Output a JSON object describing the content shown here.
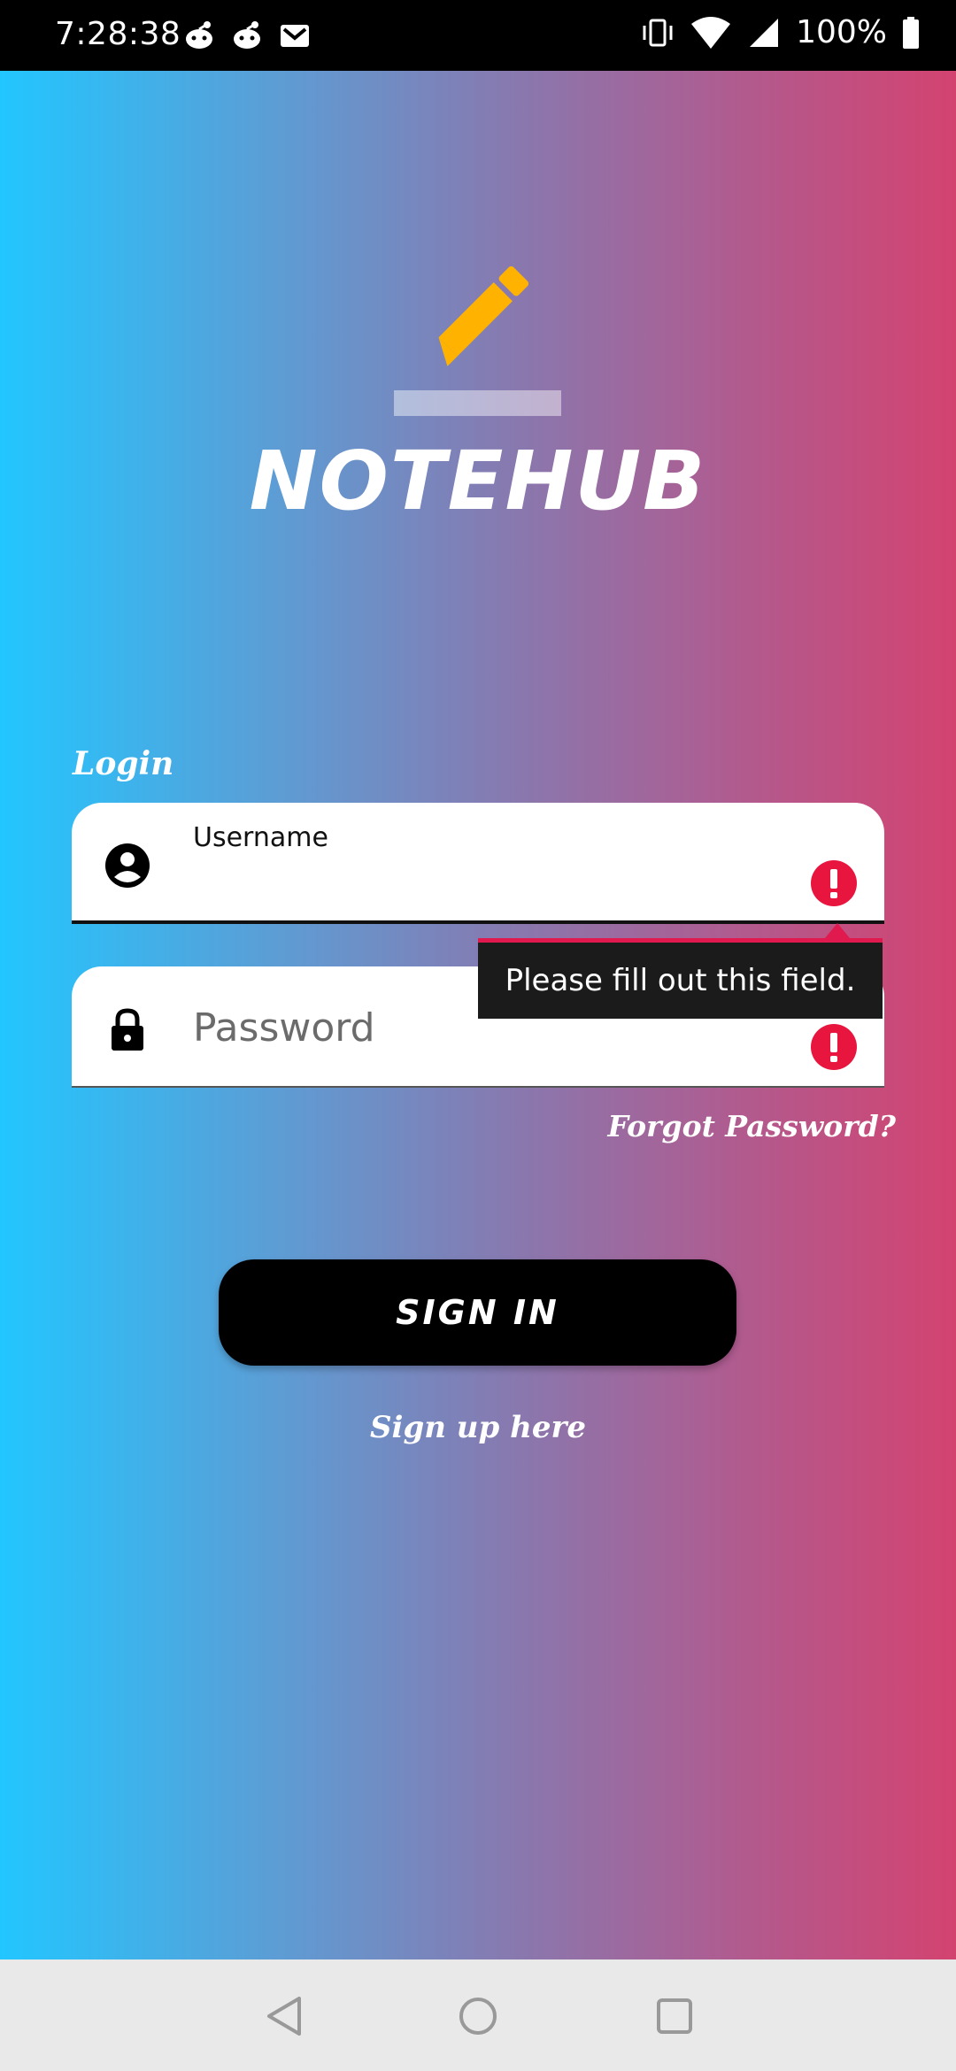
{
  "status_bar": {
    "time": "7:28:38",
    "battery": "100%",
    "left_icons": [
      "reddit-icon",
      "reddit-icon",
      "gmail-icon"
    ],
    "right_icons": [
      "vibrate-icon",
      "wifi-icon",
      "signal-icon",
      "battery-icon"
    ]
  },
  "app": {
    "title": "NOTEHUB",
    "logo_color": "#ffb300"
  },
  "form": {
    "section_label": "Login",
    "username": {
      "label": "Username",
      "value": ""
    },
    "password": {
      "placeholder": "Password",
      "value": ""
    },
    "validation_tooltip": "Please fill out this field.",
    "error_color": "#e8153f",
    "forgot_password": "Forgot Password?",
    "sign_in": "SIGN IN",
    "sign_up": "Sign up here"
  },
  "nav_bar": {
    "buttons": [
      "back-icon",
      "home-icon",
      "recents-icon"
    ]
  }
}
